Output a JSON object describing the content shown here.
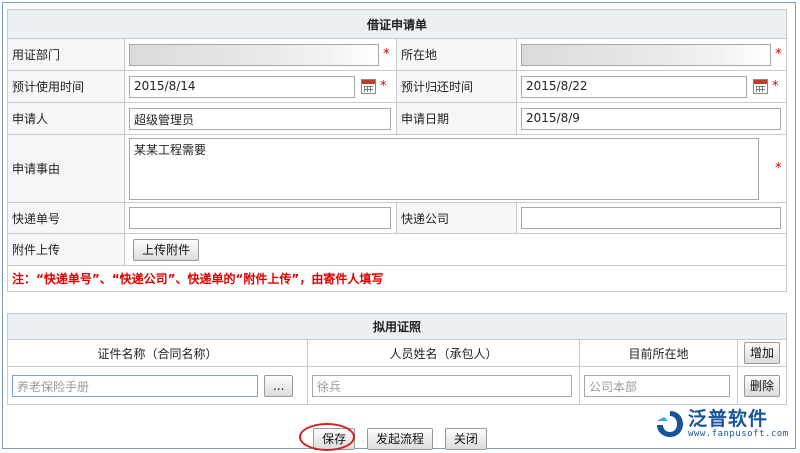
{
  "form": {
    "title": "借证申请单",
    "fields": {
      "dept_label": "用证部门",
      "location_label": "所在地",
      "start_label": "预计使用时间",
      "start_value": "2015/8/14",
      "return_label": "预计归还时间",
      "return_value": "2015/8/22",
      "applicant_label": "申请人",
      "applicant_value": "超级管理员",
      "apply_date_label": "申请日期",
      "apply_date_value": "2015/8/9",
      "reason_label": "申请事由",
      "reason_value": "某某工程需要",
      "tracking_label": "快递单号",
      "courier_label": "快递公司",
      "attach_label": "附件上传",
      "upload_button": "上传附件"
    },
    "required_mark": "*",
    "note": "注：“快递单号”、“快递公司”、快递单的“附件上传”，由寄件人填写"
  },
  "certs": {
    "title": "拟用证照",
    "columns": [
      "证件名称（合同名称）",
      "人员姓名（承包人）",
      "目前所在地"
    ],
    "add_button": "增加",
    "row": {
      "cert_name": "养老保险手册",
      "browse_button": "...",
      "person": "徐兵",
      "location": "公司本部",
      "delete_button": "删除"
    }
  },
  "actions": {
    "save": "保存",
    "start_flow": "发起流程",
    "close": "关闭"
  },
  "brand": {
    "name": "泛普软件",
    "url": "www.fanpusoft.com",
    "color": "#16549e"
  },
  "icons": [
    "calendar-icon",
    "logo-icon"
  ],
  "colors": {
    "required": "#d40000",
    "note": "#e00000",
    "highlight_ring": "#d21f1f"
  }
}
